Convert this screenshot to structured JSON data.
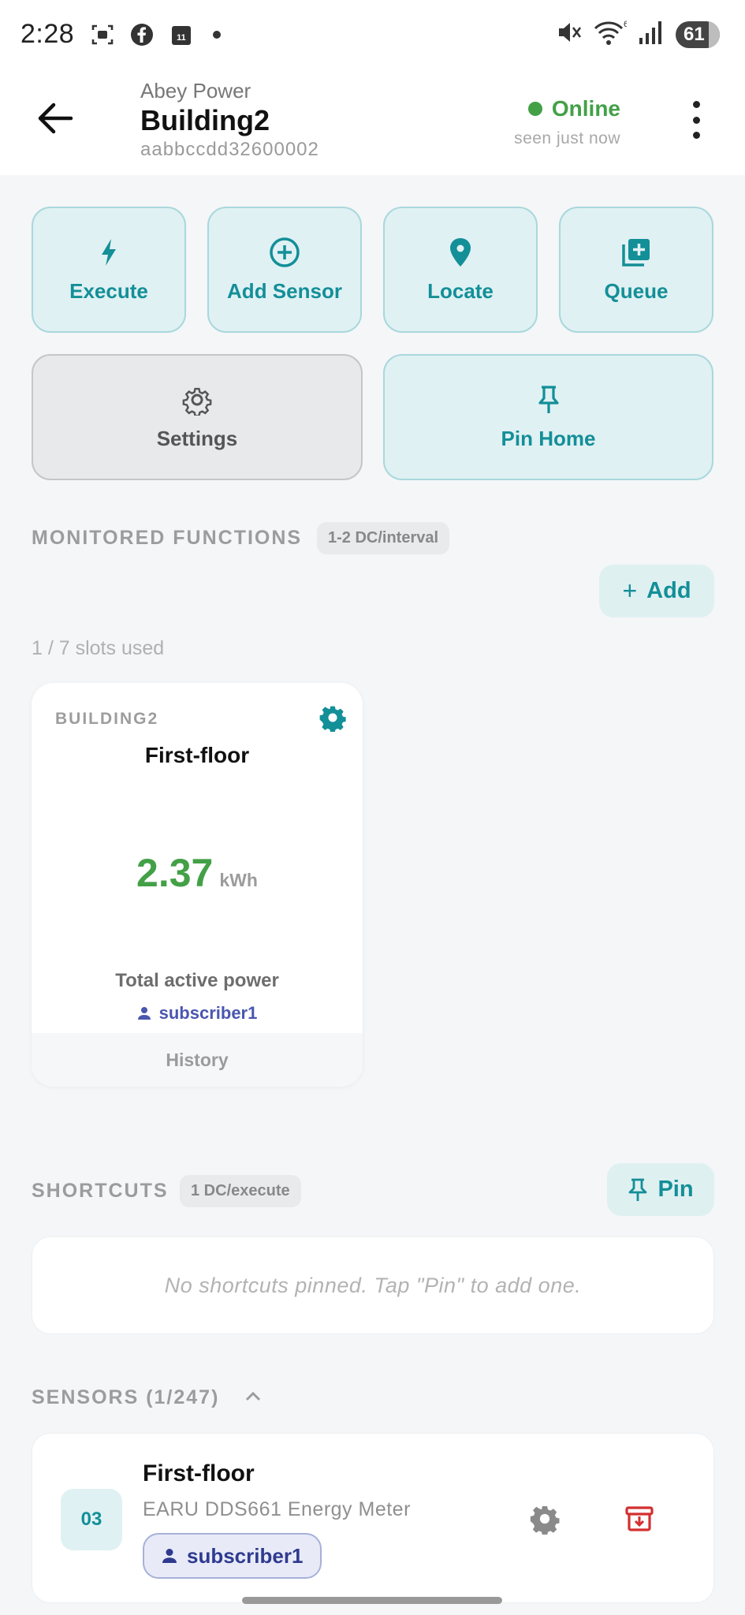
{
  "status_bar": {
    "time": "2:28",
    "calendar_day": "11",
    "battery": "61"
  },
  "header": {
    "brand": "Abey Power",
    "title": "Building2",
    "device_id": "aabbccdd32600002",
    "status": "Online",
    "seen": "seen just now"
  },
  "actions": {
    "execute": "Execute",
    "add_sensor": "Add Sensor",
    "locate": "Locate",
    "queue": "Queue",
    "settings": "Settings",
    "pin_home": "Pin Home"
  },
  "monitored": {
    "label": "MONITORED FUNCTIONS",
    "pill": "1-2 DC/interval",
    "add_label": "Add",
    "slots": "1 / 7 slots used",
    "card": {
      "group": "BUILDING2",
      "name": "First-floor",
      "value": "2.37",
      "unit": "kWh",
      "metric": "Total active power",
      "user": "subscriber1",
      "history": "History"
    }
  },
  "shortcuts": {
    "label": "SHORTCUTS",
    "pill": "1 DC/execute",
    "pin_label": "Pin",
    "empty": "No shortcuts pinned. Tap \"Pin\" to add one."
  },
  "sensors": {
    "label": "SENSORS (1/247)",
    "items": [
      {
        "number": "03",
        "name": "First-floor",
        "model": "EARU DDS661 Energy Meter",
        "user": "subscriber1"
      }
    ]
  },
  "colors": {
    "teal": "#138f98",
    "online": "#43a047",
    "danger": "#d32f2f",
    "user_blue": "#2f3a8f"
  }
}
